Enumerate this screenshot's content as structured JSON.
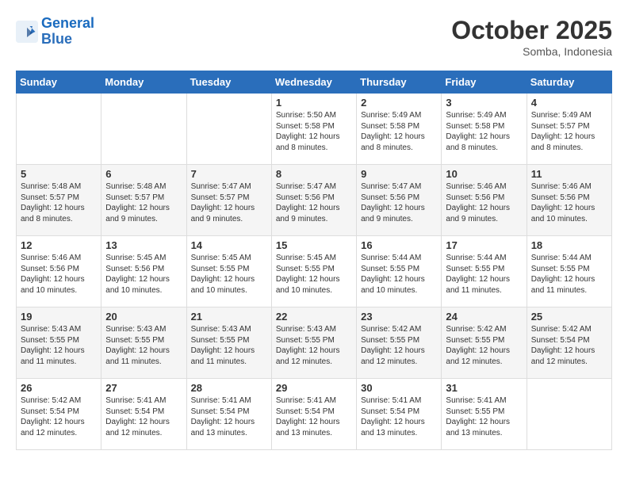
{
  "header": {
    "logo_line1": "General",
    "logo_line2": "Blue",
    "month": "October 2025",
    "location": "Somba, Indonesia"
  },
  "weekdays": [
    "Sunday",
    "Monday",
    "Tuesday",
    "Wednesday",
    "Thursday",
    "Friday",
    "Saturday"
  ],
  "weeks": [
    [
      {
        "day": "",
        "text": ""
      },
      {
        "day": "",
        "text": ""
      },
      {
        "day": "",
        "text": ""
      },
      {
        "day": "1",
        "text": "Sunrise: 5:50 AM\nSunset: 5:58 PM\nDaylight: 12 hours\nand 8 minutes."
      },
      {
        "day": "2",
        "text": "Sunrise: 5:49 AM\nSunset: 5:58 PM\nDaylight: 12 hours\nand 8 minutes."
      },
      {
        "day": "3",
        "text": "Sunrise: 5:49 AM\nSunset: 5:58 PM\nDaylight: 12 hours\nand 8 minutes."
      },
      {
        "day": "4",
        "text": "Sunrise: 5:49 AM\nSunset: 5:57 PM\nDaylight: 12 hours\nand 8 minutes."
      }
    ],
    [
      {
        "day": "5",
        "text": "Sunrise: 5:48 AM\nSunset: 5:57 PM\nDaylight: 12 hours\nand 8 minutes."
      },
      {
        "day": "6",
        "text": "Sunrise: 5:48 AM\nSunset: 5:57 PM\nDaylight: 12 hours\nand 9 minutes."
      },
      {
        "day": "7",
        "text": "Sunrise: 5:47 AM\nSunset: 5:57 PM\nDaylight: 12 hours\nand 9 minutes."
      },
      {
        "day": "8",
        "text": "Sunrise: 5:47 AM\nSunset: 5:56 PM\nDaylight: 12 hours\nand 9 minutes."
      },
      {
        "day": "9",
        "text": "Sunrise: 5:47 AM\nSunset: 5:56 PM\nDaylight: 12 hours\nand 9 minutes."
      },
      {
        "day": "10",
        "text": "Sunrise: 5:46 AM\nSunset: 5:56 PM\nDaylight: 12 hours\nand 9 minutes."
      },
      {
        "day": "11",
        "text": "Sunrise: 5:46 AM\nSunset: 5:56 PM\nDaylight: 12 hours\nand 10 minutes."
      }
    ],
    [
      {
        "day": "12",
        "text": "Sunrise: 5:46 AM\nSunset: 5:56 PM\nDaylight: 12 hours\nand 10 minutes."
      },
      {
        "day": "13",
        "text": "Sunrise: 5:45 AM\nSunset: 5:56 PM\nDaylight: 12 hours\nand 10 minutes."
      },
      {
        "day": "14",
        "text": "Sunrise: 5:45 AM\nSunset: 5:55 PM\nDaylight: 12 hours\nand 10 minutes."
      },
      {
        "day": "15",
        "text": "Sunrise: 5:45 AM\nSunset: 5:55 PM\nDaylight: 12 hours\nand 10 minutes."
      },
      {
        "day": "16",
        "text": "Sunrise: 5:44 AM\nSunset: 5:55 PM\nDaylight: 12 hours\nand 10 minutes."
      },
      {
        "day": "17",
        "text": "Sunrise: 5:44 AM\nSunset: 5:55 PM\nDaylight: 12 hours\nand 11 minutes."
      },
      {
        "day": "18",
        "text": "Sunrise: 5:44 AM\nSunset: 5:55 PM\nDaylight: 12 hours\nand 11 minutes."
      }
    ],
    [
      {
        "day": "19",
        "text": "Sunrise: 5:43 AM\nSunset: 5:55 PM\nDaylight: 12 hours\nand 11 minutes."
      },
      {
        "day": "20",
        "text": "Sunrise: 5:43 AM\nSunset: 5:55 PM\nDaylight: 12 hours\nand 11 minutes."
      },
      {
        "day": "21",
        "text": "Sunrise: 5:43 AM\nSunset: 5:55 PM\nDaylight: 12 hours\nand 11 minutes."
      },
      {
        "day": "22",
        "text": "Sunrise: 5:43 AM\nSunset: 5:55 PM\nDaylight: 12 hours\nand 12 minutes."
      },
      {
        "day": "23",
        "text": "Sunrise: 5:42 AM\nSunset: 5:55 PM\nDaylight: 12 hours\nand 12 minutes."
      },
      {
        "day": "24",
        "text": "Sunrise: 5:42 AM\nSunset: 5:55 PM\nDaylight: 12 hours\nand 12 minutes."
      },
      {
        "day": "25",
        "text": "Sunrise: 5:42 AM\nSunset: 5:54 PM\nDaylight: 12 hours\nand 12 minutes."
      }
    ],
    [
      {
        "day": "26",
        "text": "Sunrise: 5:42 AM\nSunset: 5:54 PM\nDaylight: 12 hours\nand 12 minutes."
      },
      {
        "day": "27",
        "text": "Sunrise: 5:41 AM\nSunset: 5:54 PM\nDaylight: 12 hours\nand 12 minutes."
      },
      {
        "day": "28",
        "text": "Sunrise: 5:41 AM\nSunset: 5:54 PM\nDaylight: 12 hours\nand 13 minutes."
      },
      {
        "day": "29",
        "text": "Sunrise: 5:41 AM\nSunset: 5:54 PM\nDaylight: 12 hours\nand 13 minutes."
      },
      {
        "day": "30",
        "text": "Sunrise: 5:41 AM\nSunset: 5:54 PM\nDaylight: 12 hours\nand 13 minutes."
      },
      {
        "day": "31",
        "text": "Sunrise: 5:41 AM\nSunset: 5:55 PM\nDaylight: 12 hours\nand 13 minutes."
      },
      {
        "day": "",
        "text": ""
      }
    ]
  ]
}
